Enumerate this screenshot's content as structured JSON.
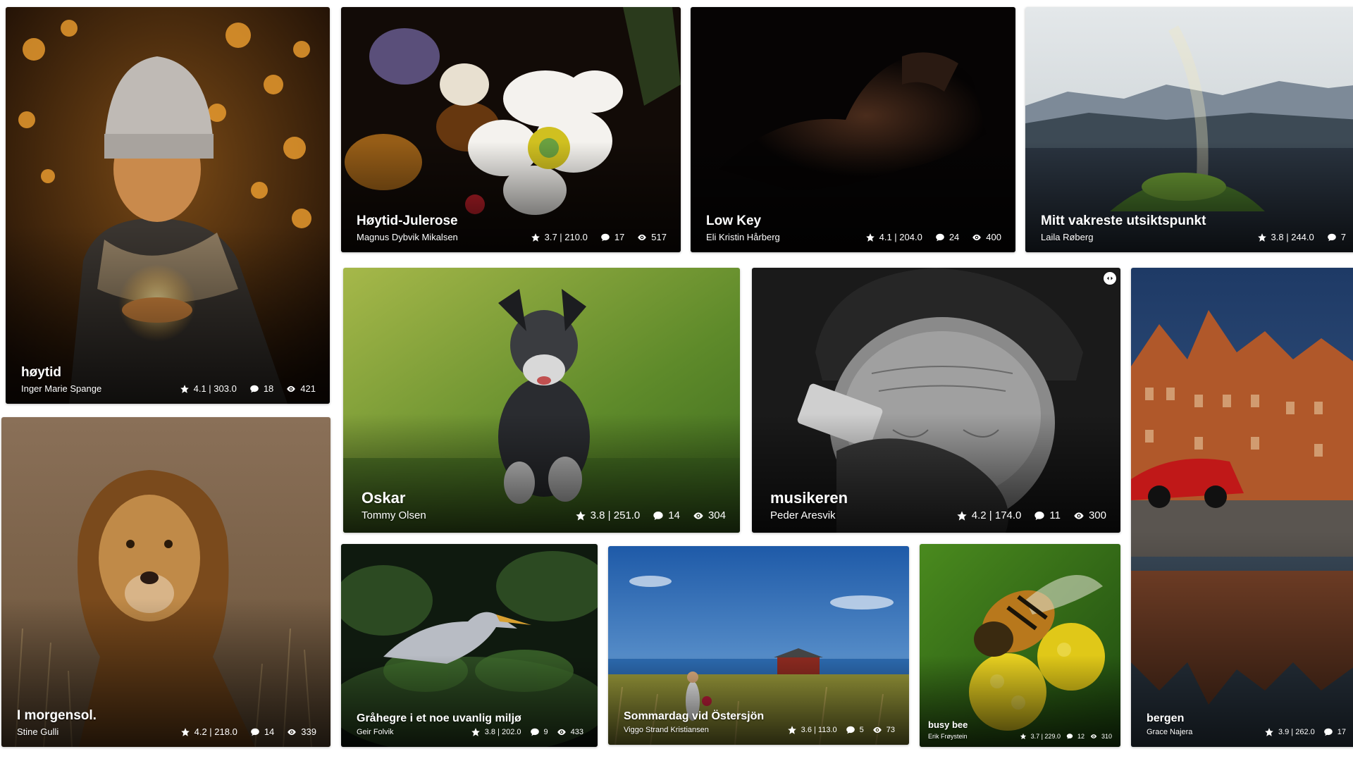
{
  "photos": [
    {
      "title": "høytid",
      "author": "Inger Marie Spange",
      "rating": "4.1 | 303.0",
      "comments": "18",
      "views": "421",
      "subject": "girl-with-lights"
    },
    {
      "title": "Høytid-Julerose",
      "author": "Magnus Dybvik Mikalsen",
      "rating": "3.7 | 210.0",
      "comments": "17",
      "views": "517",
      "subject": "christmas-rose"
    },
    {
      "title": "Low Key",
      "author": "Eli Kristin Hårberg",
      "rating": "4.1 | 204.0",
      "comments": "24",
      "views": "400",
      "subject": "low-key-portrait"
    },
    {
      "title": "Mitt vakreste utsiktspunkt",
      "author": "Laila Røberg",
      "rating": "3.8 | 244.0",
      "comments": "7",
      "views": "",
      "subject": "fjord-rainbow"
    },
    {
      "title": "Oskar",
      "author": "Tommy Olsen",
      "rating": "3.8 | 251.0",
      "comments": "14",
      "views": "304",
      "subject": "running-dog"
    },
    {
      "title": "musikeren",
      "author": "Peder Aresvik",
      "rating": "4.2 | 174.0",
      "comments": "11",
      "views": "300",
      "subject": "harmonica-player"
    },
    {
      "title": "bergen",
      "author": "Grace Najera",
      "rating": "3.9 | 262.0",
      "comments": "17",
      "views": "",
      "subject": "bryggen-reflection"
    },
    {
      "title": "I morgensol.",
      "author": "Stine Gulli",
      "rating": "4.2 | 218.0",
      "comments": "14",
      "views": "339",
      "subject": "lion"
    },
    {
      "title": "Gråhegre i et noe uvanlig miljø",
      "author": "Geir Folvik",
      "rating": "3.8 | 202.0",
      "comments": "9",
      "views": "433",
      "subject": "grey-heron"
    },
    {
      "title": "Sommardag vid Östersjön",
      "author": "Viggo Strand Kristiansen",
      "rating": "3.6 | 113.0",
      "comments": "5",
      "views": "73",
      "subject": "baltic-summer"
    },
    {
      "title": "busy bee",
      "author": "Erik Frøystein",
      "rating": "3.7 | 229.0",
      "comments": "12",
      "views": "310",
      "subject": "bee-on-flower"
    }
  ],
  "icons": {
    "rating": "star-icon",
    "comments": "comment-icon",
    "views": "eye-icon",
    "toggle": "expand-toggle-icon"
  },
  "colors": {
    "caption_text": "#ffffff",
    "background": "#ffffff"
  }
}
